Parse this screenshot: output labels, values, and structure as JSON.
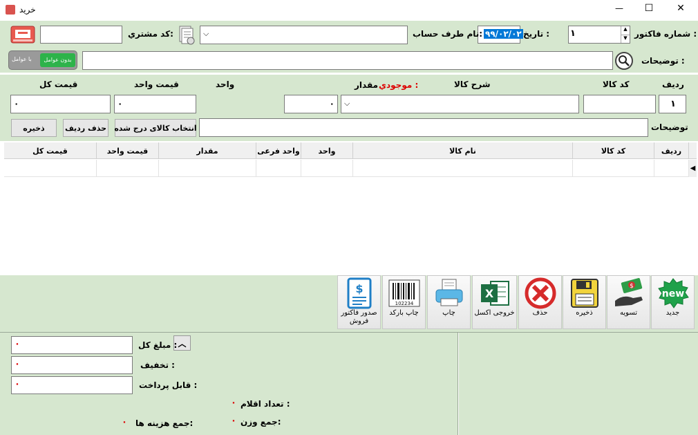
{
  "window": {
    "title": "خرید",
    "minimize": "—",
    "maximize": "☐",
    "close": "✕"
  },
  "header": {
    "invoice_no_label": "شماره فاکتور :",
    "invoice_no_value": "۱",
    "date_label": "تاریخ :",
    "date_value": "۹۹/۰۲/۰۲",
    "account_label": "نام طرف حساب:",
    "customer_code_label": "کد مشتري:",
    "description_label": "توضیحات :",
    "toggle_on": "بدون عوامل",
    "toggle_off": "با عوامل"
  },
  "entry": {
    "row_label": "ردیف",
    "code_label": "کد کالا",
    "desc_label": "شرح کالا",
    "stock_label": "موجودي :",
    "qty_label": "مقدار",
    "unit_label": "واحد",
    "unit_price_label": "قیمت واحد",
    "total_label": "قیمت کل",
    "row_value": "۱",
    "qty_value": "۰",
    "unit_price_value": "۰",
    "total_value": "۰",
    "notes_label": "توضیحات",
    "select_button": "انتخاب کالای درج شده",
    "delete_row_button": "حذف ردیف",
    "save_button": "ذخیره"
  },
  "table": {
    "columns": [
      "ردیف",
      "کد کالا",
      "نام کالا",
      "واحد",
      "واحد فرعی",
      "مقدار",
      "قیمت واحد",
      "قیمت کل"
    ]
  },
  "toolbar": {
    "new": "جدید",
    "new_icon_text": "new",
    "settle": "تسویه",
    "save": "ذخیره",
    "delete": "حذف",
    "excel": "خروجی اکسل",
    "print": "چاپ",
    "barcode": "چاپ بارکد",
    "barcode_number": "102234",
    "issue_invoice": "صدور فاکتور فروش"
  },
  "summary": {
    "total_label": "مبلغ کل :",
    "discount_label": "تخفیف :",
    "payable_label": "قابل پرداخت :",
    "items_count_label": "تعداد اقلام :",
    "weight_label": "جمع وزن:",
    "costs_label": "جمع هزینه ها:",
    "total_value": "۰",
    "discount_value": "۰",
    "payable_value": "۰",
    "items_count_value": "۰",
    "weight_value": "۰",
    "costs_value": "۰"
  },
  "colors": {
    "panel": "#d6e7cf",
    "selection": "#0078d7",
    "error": "#d00000"
  }
}
